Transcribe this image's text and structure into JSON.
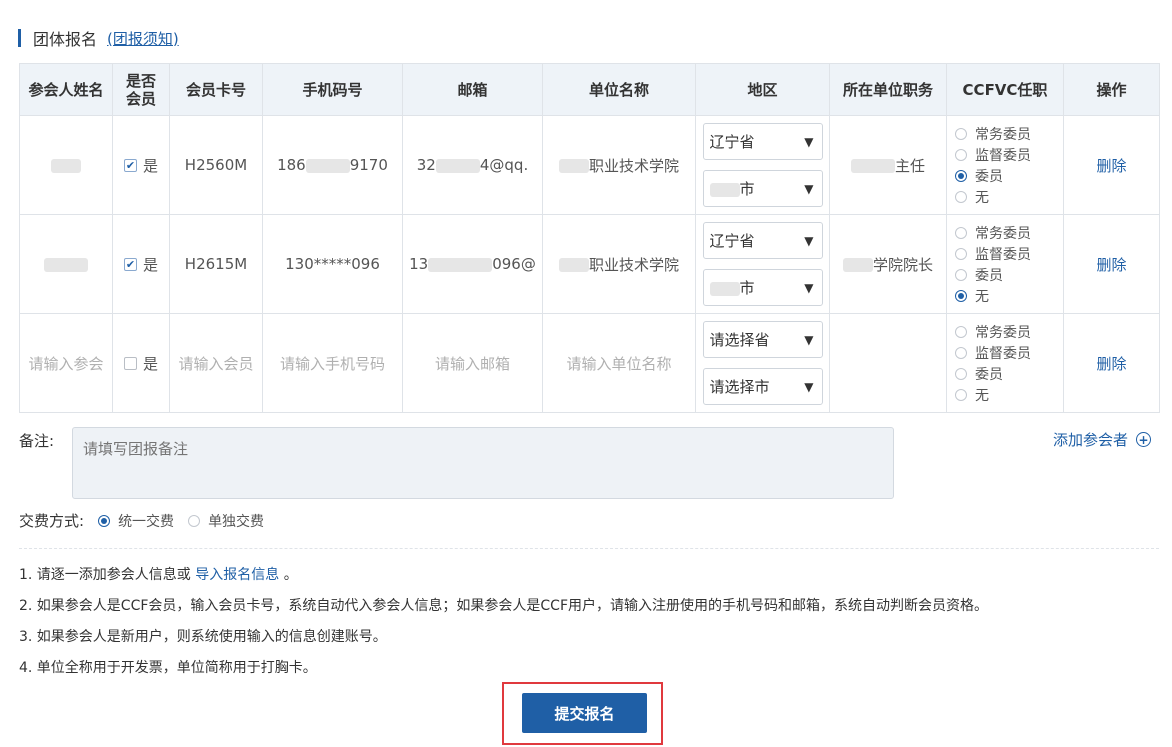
{
  "section": {
    "title": "团体报名",
    "notice_link": "(团报须知)"
  },
  "table": {
    "headers": [
      "参会人姓名",
      "是否会员",
      "会员卡号",
      "手机码号",
      "邮箱",
      "单位名称",
      "地区",
      "所在单位职务",
      "CCFVC任职",
      "操作"
    ],
    "header_is_member_line1": "是否",
    "header_is_member_line2": "会员",
    "rows": [
      {
        "is_member_label": "是",
        "member_card": "H2560M",
        "phone_prefix": "186",
        "phone_suffix": "9170",
        "email_prefix": "32",
        "email_suffix": "4@qq.",
        "org_suffix": "职业技术学院",
        "province": "辽宁省",
        "city_suffix": "市",
        "position_suffix": "主任",
        "roles": [
          "常务委员",
          "监督委员",
          "委员",
          "无"
        ],
        "role_selected": 2,
        "delete_label": "删除"
      },
      {
        "is_member_label": "是",
        "member_card": "H2615M",
        "phone": "130*****096",
        "email_prefix": "13",
        "email_suffix": "096@",
        "org_suffix": "职业技术学院",
        "province": "辽宁省",
        "city_suffix": "市",
        "position_suffix": "学院院长",
        "roles": [
          "常务委员",
          "监督委员",
          "委员",
          "无"
        ],
        "role_selected": 3,
        "delete_label": "删除"
      },
      {
        "name_placeholder": "请输入参会",
        "is_member_label": "是",
        "member_card_placeholder": "请输入会员",
        "phone_placeholder": "请输入手机号码",
        "email_placeholder": "请输入邮箱",
        "org_placeholder": "请输入单位名称",
        "province_placeholder": "请选择省",
        "city_placeholder": "请选择市",
        "roles": [
          "常务委员",
          "监督委员",
          "委员",
          "无"
        ],
        "delete_label": "删除"
      }
    ]
  },
  "remark": {
    "label": "备注:",
    "placeholder": "请填写团报备注"
  },
  "add_participant": "添加参会者",
  "payment": {
    "label": "交费方式:",
    "options": [
      "统一交费",
      "单独交费"
    ],
    "selected": 0
  },
  "notes": {
    "line1_text": "1. 请逐一添加参会人信息或",
    "line1_link": "导入报名信息",
    "line1_end": "。",
    "line2": "2. 如果参会人是CCF会员，输入会员卡号，系统自动代入参会人信息；如果参会人是CCF用户，请输入注册使用的手机号码和邮箱，系统自动判断会员资格。",
    "line3": "3. 如果参会人是新用户，则系统使用输入的信息创建账号。",
    "line4": "4. 单位全称用于开发票，单位简称用于打胸卡。"
  },
  "submit_label": "提交报名",
  "colors": {
    "accent": "#1f5fa6",
    "highlight": "#e0393e",
    "header_bg": "#eef3f8"
  }
}
